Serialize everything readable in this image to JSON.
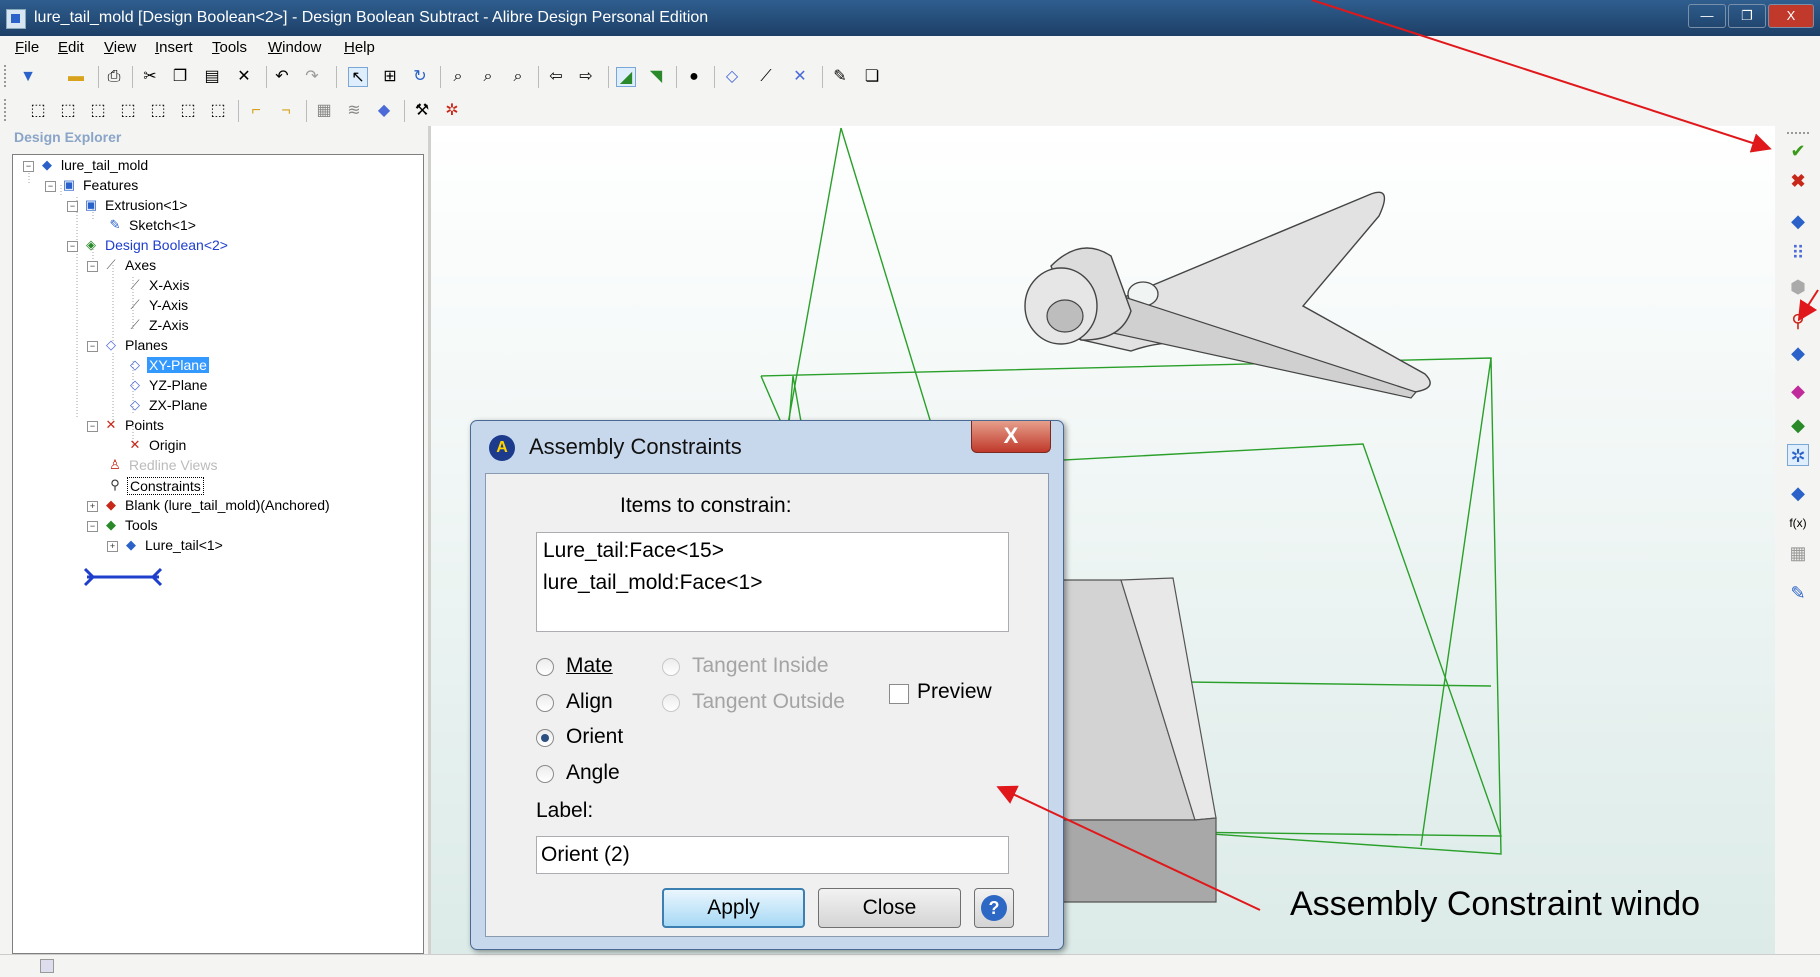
{
  "window": {
    "title": "lure_tail_mold [Design Boolean<2>] - Design Boolean Subtract - Alibre Design Personal Edition",
    "minimize": "—",
    "maximize": "❐",
    "close": "X"
  },
  "menubar": [
    "File",
    "Edit",
    "View",
    "Insert",
    "Tools",
    "Window",
    "Help"
  ],
  "explorer": {
    "title": "Design Explorer",
    "tree": [
      {
        "label": "lure_tail_mold",
        "icon": "part-icon"
      },
      {
        "label": "Features",
        "icon": "features-icon"
      },
      {
        "label": "Extrusion<1>",
        "icon": "extrusion-icon"
      },
      {
        "label": "Sketch<1>",
        "icon": "sketch-icon"
      },
      {
        "label": "Design Boolean<2>",
        "icon": "boolean-icon"
      },
      {
        "label": "Axes",
        "icon": "axis-icon"
      },
      {
        "label": "X-Axis",
        "icon": "axis-icon"
      },
      {
        "label": "Y-Axis",
        "icon": "axis-icon"
      },
      {
        "label": "Z-Axis",
        "icon": "axis-icon"
      },
      {
        "label": "Planes",
        "icon": "plane-icon"
      },
      {
        "label": "XY-Plane",
        "icon": "plane-icon"
      },
      {
        "label": "YZ-Plane",
        "icon": "plane-icon"
      },
      {
        "label": "ZX-Plane",
        "icon": "plane-icon"
      },
      {
        "label": "Points",
        "icon": "point-icon"
      },
      {
        "label": "Origin",
        "icon": "point-icon"
      },
      {
        "label": "Redline Views",
        "icon": "redline-icon"
      },
      {
        "label": "Constraints",
        "icon": "constraint-icon"
      },
      {
        "label": "Blank (lure_tail_mold)(Anchored)",
        "icon": "blank-icon"
      },
      {
        "label": "Tools",
        "icon": "tools-icon"
      },
      {
        "label": "Lure_tail<1>",
        "icon": "part-icon"
      }
    ]
  },
  "dialog": {
    "title": "Assembly Constraints",
    "close": "X",
    "items_label": "Items to constrain:",
    "items": [
      "Lure_tail:Face<15>",
      "lure_tail_mold:Face<1>"
    ],
    "options": {
      "mate": "Mate",
      "align": "Align",
      "orient": "Orient",
      "angle": "Angle",
      "tangent_inside": "Tangent Inside",
      "tangent_outside": "Tangent Outside"
    },
    "selected": "Orient",
    "preview": "Preview",
    "label_caption": "Label:",
    "label_value": "Orient (2)",
    "apply": "Apply",
    "close_button": "Close",
    "help": "?"
  },
  "right_toolbar": {
    "fx": "f(x)"
  },
  "annotation": "Assembly Constraint windo",
  "colors": {
    "arrow": "#e0181b",
    "wireframe": "#22aa22",
    "selection": "#3399ff"
  }
}
